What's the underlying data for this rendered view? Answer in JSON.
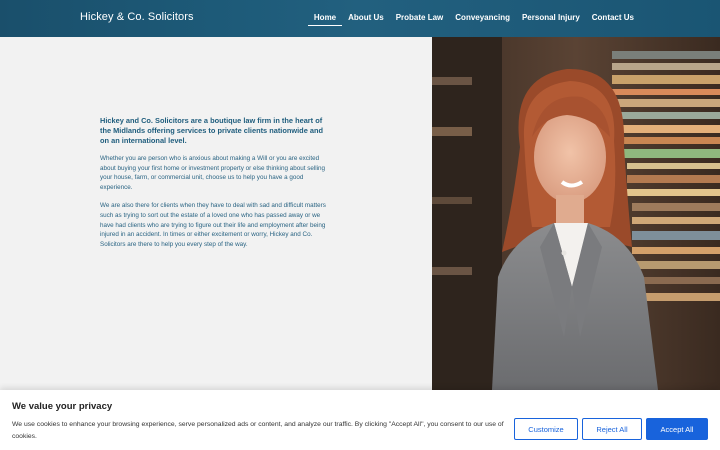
{
  "header": {
    "logo_text": "Hickey & Co. Solicitors",
    "nav": [
      {
        "label": "Home",
        "active": true
      },
      {
        "label": "About Us"
      },
      {
        "label": "Probate Law"
      },
      {
        "label": "Conveyancing"
      },
      {
        "label": "Personal Injury"
      },
      {
        "label": "Contact Us"
      }
    ]
  },
  "main": {
    "lead": "Hickey and Co. Solicitors are a boutique law firm in the heart of the Midlands offering services to private clients nationwide and on an international level.",
    "paragraph_1": "Whether you are person who is anxious about making a Will or you are excited about buying your first home or investment property or else thinking about selling your house, farm, or commercial unit, choose us to help you have a good experience.",
    "paragraph_2": "We are also there for clients when they have to deal with sad and difficult matters such as trying to sort out the estate of a loved one who has passed away or we have had clients who are trying to figure out their life and employment after being injured in an accident. In times or either excitement or worry, Hickey and Co. Solicitors are there to help you every step of the way."
  },
  "cookie_banner": {
    "title": "We value your privacy",
    "text": "We use cookies to enhance your browsing experience, serve personalized ads or content, and analyze our traffic. By clicking \"Accept All\", you consent to our use of cookies.",
    "customize_label": "Customize",
    "reject_label": "Reject All",
    "accept_label": "Accept All"
  },
  "colors": {
    "header_bg": "#1d5a78",
    "text_blue": "#1f5d7d",
    "button_blue": "#1863dc"
  }
}
